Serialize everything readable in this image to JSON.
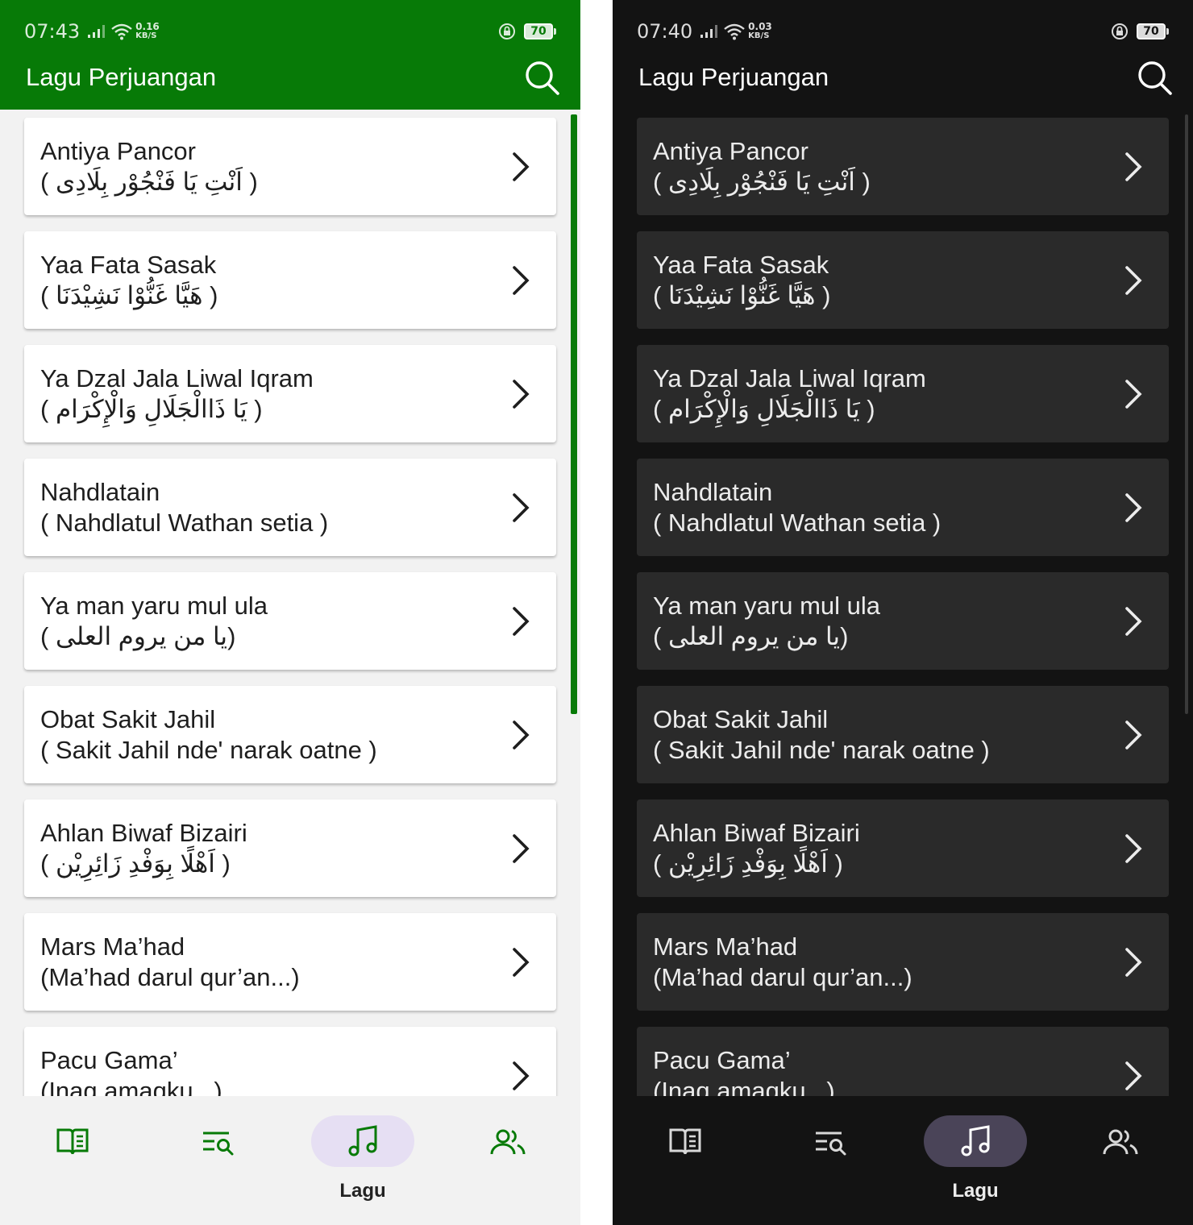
{
  "light": {
    "status": {
      "time": "07:43",
      "speed_value": "0.16",
      "speed_unit": "KB/S",
      "battery": "70"
    },
    "appbar": {
      "title": "Lagu Perjuangan"
    }
  },
  "dark": {
    "status": {
      "time": "07:40",
      "speed_value": "0.03",
      "speed_unit": "KB/S",
      "battery": "70"
    },
    "appbar": {
      "title": "Lagu Perjuangan"
    }
  },
  "songs": [
    {
      "title": "Antiya Pancor",
      "subtitle": "( اَنْتِ يَا فَنْجُوْر بِلَادِى )"
    },
    {
      "title": "Yaa Fata Sasak",
      "subtitle": "( هَيَّا غَنُّوْا نَشِيْدَنَا )"
    },
    {
      "title": "Ya Dzal Jala Liwal Iqram",
      "subtitle": "( يَا ذَاالْجَلَالِ وَالْإِكْرَام )"
    },
    {
      "title": "Nahdlatain",
      "subtitle": "( Nahdlatul Wathan setia )"
    },
    {
      "title": "Ya man yaru mul ula",
      "subtitle": "( يا من يروم العلى)"
    },
    {
      "title": "Obat Sakit Jahil",
      "subtitle": "( Sakit Jahil nde' narak oatne )"
    },
    {
      "title": "Ahlan Biwaf Bizairi",
      "subtitle": "( اَهْلًا بِوَفْدِ زَائِرِيْن )"
    },
    {
      "title": "Mars Ma’had",
      "subtitle": "(Ma’had darul qur’an...)"
    },
    {
      "title": "Pacu Gama’",
      "subtitle": "(Inaq amaqku...)"
    }
  ],
  "bottom_nav": {
    "items": [
      {
        "icon": "book-icon",
        "label": ""
      },
      {
        "icon": "list-search-icon",
        "label": ""
      },
      {
        "icon": "music-note-icon",
        "label": "Lagu",
        "active": true
      },
      {
        "icon": "people-icon",
        "label": ""
      }
    ]
  },
  "colors": {
    "light_primary": "#077a07",
    "light_background": "#f2f2f2",
    "dark_background": "#131313",
    "dark_card": "#2a2a2a",
    "light_active_pill": "#e6dff3",
    "dark_active_pill": "#4a4458"
  }
}
